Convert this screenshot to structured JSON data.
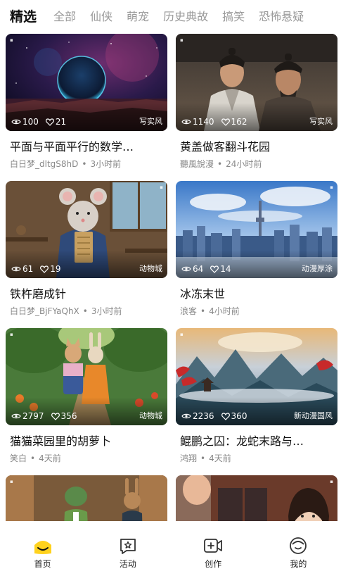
{
  "tabs": [
    {
      "label": "精选",
      "active": true
    },
    {
      "label": "全部",
      "active": false
    },
    {
      "label": "仙侠",
      "active": false
    },
    {
      "label": "萌宠",
      "active": false
    },
    {
      "label": "历史典故",
      "active": false
    },
    {
      "label": "搞笑",
      "active": false
    },
    {
      "label": "恐怖悬疑",
      "active": false
    }
  ],
  "cards": [
    {
      "views": "100",
      "likes": "21",
      "style": "写实风",
      "title": "平面与平面平行的数学…",
      "author": "白日梦_dltgS8hD",
      "time": "3小时前"
    },
    {
      "views": "1140",
      "likes": "162",
      "style": "写实风",
      "title": "黄盖做客翻斗花园",
      "author": "聽風說漫",
      "time": "24小时前"
    },
    {
      "views": "61",
      "likes": "19",
      "style": "动物城",
      "title": "铁杵磨成针",
      "author": "白日梦_BjFYaQhX",
      "time": "3小时前"
    },
    {
      "views": "64",
      "likes": "14",
      "style": "动漫厚涂",
      "title": "冰冻末世",
      "author": "浪客",
      "time": "4小时前"
    },
    {
      "views": "2797",
      "likes": "356",
      "style": "动物城",
      "title": "猫猫菜园里的胡萝卜",
      "author": "笑白",
      "time": "4天前"
    },
    {
      "views": "2236",
      "likes": "360",
      "style": "新动漫国风",
      "title": "鲲鹏之囚：龙蛇末路与…",
      "author": "鸿翔",
      "time": "4天前"
    }
  ],
  "bottom_nav": [
    {
      "label": "首页",
      "icon": "home-icon",
      "active": true
    },
    {
      "label": "活动",
      "icon": "activity-icon",
      "active": false
    },
    {
      "label": "创作",
      "icon": "create-icon",
      "active": false
    },
    {
      "label": "我的",
      "icon": "profile-icon",
      "active": false
    }
  ],
  "colors": {
    "accent": "#FFD21E",
    "text": "#111111",
    "muted": "#888888"
  }
}
